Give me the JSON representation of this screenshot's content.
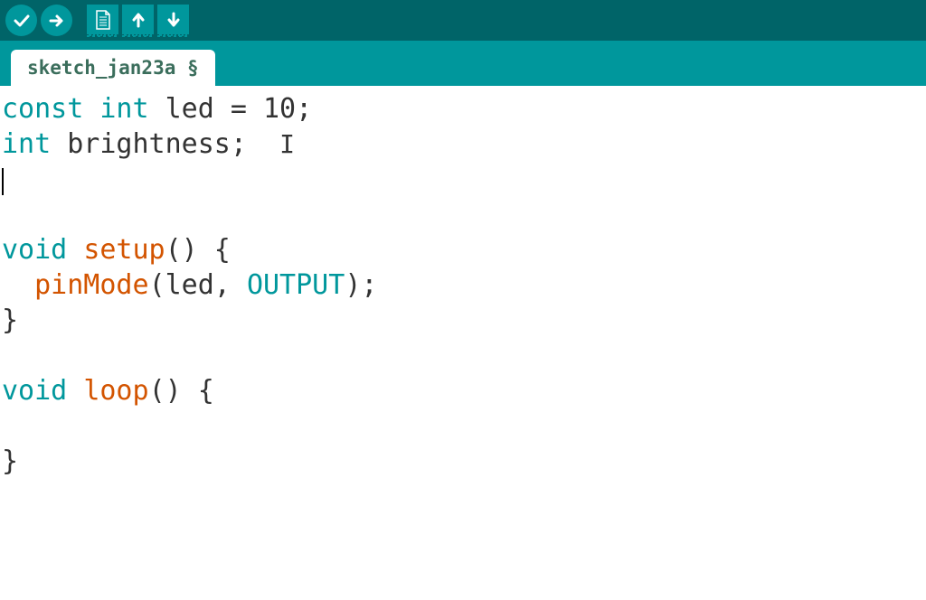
{
  "toolbar": {
    "verify_icon": "check-icon",
    "upload_icon": "arrow-right-icon",
    "new_icon": "file-icon",
    "open_icon": "arrow-up-icon",
    "save_icon": "arrow-down-icon"
  },
  "tabs": [
    {
      "label": "sketch_jan23a §"
    }
  ],
  "code": {
    "lines": [
      {
        "indent": "",
        "tokens": [
          {
            "text": "const",
            "cls": "tok-keyword"
          },
          {
            "text": " ",
            "cls": "tok-plain"
          },
          {
            "text": "int",
            "cls": "tok-type"
          },
          {
            "text": " led = ",
            "cls": "tok-plain"
          },
          {
            "text": "10",
            "cls": "tok-number"
          },
          {
            "text": ";",
            "cls": "tok-plain"
          }
        ]
      },
      {
        "indent": "",
        "tokens": [
          {
            "text": "int",
            "cls": "tok-type"
          },
          {
            "text": " brightness;  ",
            "cls": "tok-plain"
          }
        ],
        "ibeam": true
      },
      {
        "indent": "",
        "line_cursor": true,
        "tokens": []
      },
      {
        "indent": "",
        "tokens": []
      },
      {
        "indent": "",
        "tokens": [
          {
            "text": "void",
            "cls": "tok-keyword"
          },
          {
            "text": " ",
            "cls": "tok-plain"
          },
          {
            "text": "setup",
            "cls": "tok-builtin"
          },
          {
            "text": "() {",
            "cls": "tok-plain"
          }
        ]
      },
      {
        "indent": "  ",
        "tokens": [
          {
            "text": "pinMode",
            "cls": "tok-builtin"
          },
          {
            "text": "(led, ",
            "cls": "tok-plain"
          },
          {
            "text": "OUTPUT",
            "cls": "tok-const"
          },
          {
            "text": ");",
            "cls": "tok-plain"
          }
        ]
      },
      {
        "indent": "",
        "tokens": [
          {
            "text": "}",
            "cls": "tok-plain"
          }
        ]
      },
      {
        "indent": "",
        "tokens": []
      },
      {
        "indent": "",
        "tokens": [
          {
            "text": "void",
            "cls": "tok-keyword"
          },
          {
            "text": " ",
            "cls": "tok-plain"
          },
          {
            "text": "loop",
            "cls": "tok-builtin"
          },
          {
            "text": "() {",
            "cls": "tok-plain"
          }
        ]
      },
      {
        "indent": "",
        "tokens": []
      },
      {
        "indent": "",
        "tokens": [
          {
            "text": "}",
            "cls": "tok-plain"
          }
        ]
      }
    ]
  }
}
